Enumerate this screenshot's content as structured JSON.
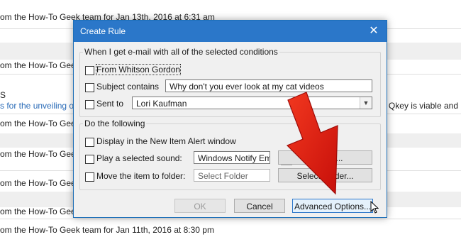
{
  "background": {
    "line1": "om the How-To Geek team for Jan 13th, 2016 at 6:31 am",
    "line2": "om the How-To Geek",
    "line3_fragment": "S",
    "line4": "s for the unveiling o",
    "line4_right": "at Qkey is viable and",
    "line5": "om the How-To Geek",
    "line6": "om the How-To Geek",
    "line7": "om the How-To Geek",
    "line8": "om the How-To Geek",
    "line9": "om the How-To Geek team for Jan 11th, 2016 at 8:30 pm"
  },
  "dialog": {
    "title": "Create Rule",
    "close_label": "✕",
    "conditions": {
      "legend": "When I get e-mail with all of the selected conditions",
      "from_label": "From Whitson Gordon",
      "subject_label": "Subject contains",
      "subject_value": "Why don't you ever look at my cat videos",
      "sent_to_label": "Sent to",
      "sent_to_value": "Lori Kaufman",
      "sent_to_dropdown_icon": "chevron-down-icon"
    },
    "actions": {
      "legend": "Do the following",
      "alert_label": "Display in the New Item Alert window",
      "sound_label": "Play a selected sound:",
      "sound_value": "Windows Notify Em",
      "play_symbol": "▶",
      "browse_label": "Browse...",
      "move_label": "Move the item to folder:",
      "folder_placeholder": "Select Folder",
      "select_folder_label": "Select Folder..."
    },
    "buttons": {
      "ok": "OK",
      "cancel": "Cancel",
      "advanced": "Advanced Options..."
    }
  },
  "colors": {
    "titlebar": "#2b77c9",
    "arrow": "#e31b12"
  }
}
